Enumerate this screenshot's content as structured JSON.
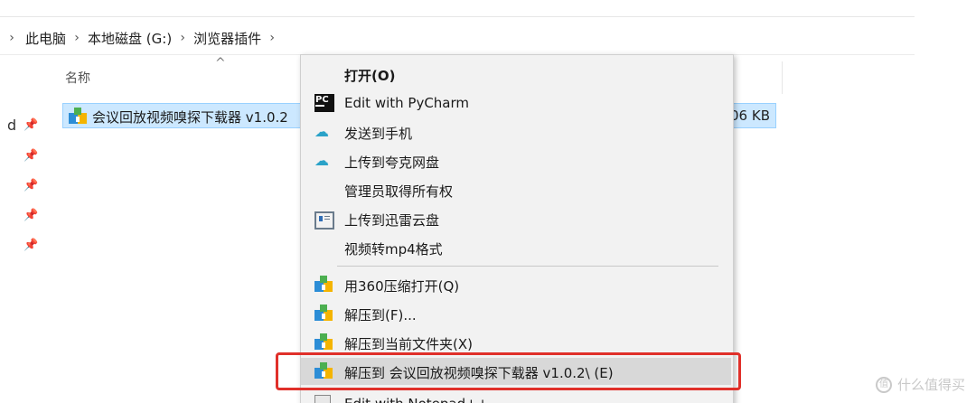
{
  "breadcrumb": [
    "此电脑",
    "本地磁盘 (G:)",
    "浏览器插件"
  ],
  "column_header": "名称",
  "left_nav": {
    "letter": "d"
  },
  "file": {
    "name": "会议回放视频嗅探下载器 v1.0.2",
    "size": "06 KB"
  },
  "context_menu": {
    "items": [
      {
        "label": "打开(O)",
        "icon": "",
        "bold": true
      },
      {
        "label": "Edit with PyCharm",
        "icon": "pycharm-icon"
      },
      {
        "label": "发送到手机",
        "icon": "cloud-icon"
      },
      {
        "label": "上传到夸克网盘",
        "icon": "cloud-icon"
      },
      {
        "label": "管理员取得所有权",
        "icon": ""
      },
      {
        "label": "上传到迅雷云盘",
        "icon": "thunder-cloud-icon"
      },
      {
        "label": "视频转mp4格式",
        "icon": ""
      },
      {
        "label": "用360压缩打开(Q)",
        "icon": "archive-icon"
      },
      {
        "label": "解压到(F)...",
        "icon": "archive-icon"
      },
      {
        "label": "解压到当前文件夹(X)",
        "icon": "archive-icon"
      },
      {
        "label": "解压到 会议回放视频嗅探下载器 v1.0.2\\ (E)",
        "icon": "archive-icon",
        "highlighted": true
      },
      {
        "label": "Edit with Notepad++",
        "icon": "notepad-icon"
      }
    ]
  },
  "watermark": "什么值得买",
  "colors": {
    "selection": "#cce8ff",
    "highlight_box": "#e0302a",
    "menu_bg": "#f2f2f2"
  }
}
